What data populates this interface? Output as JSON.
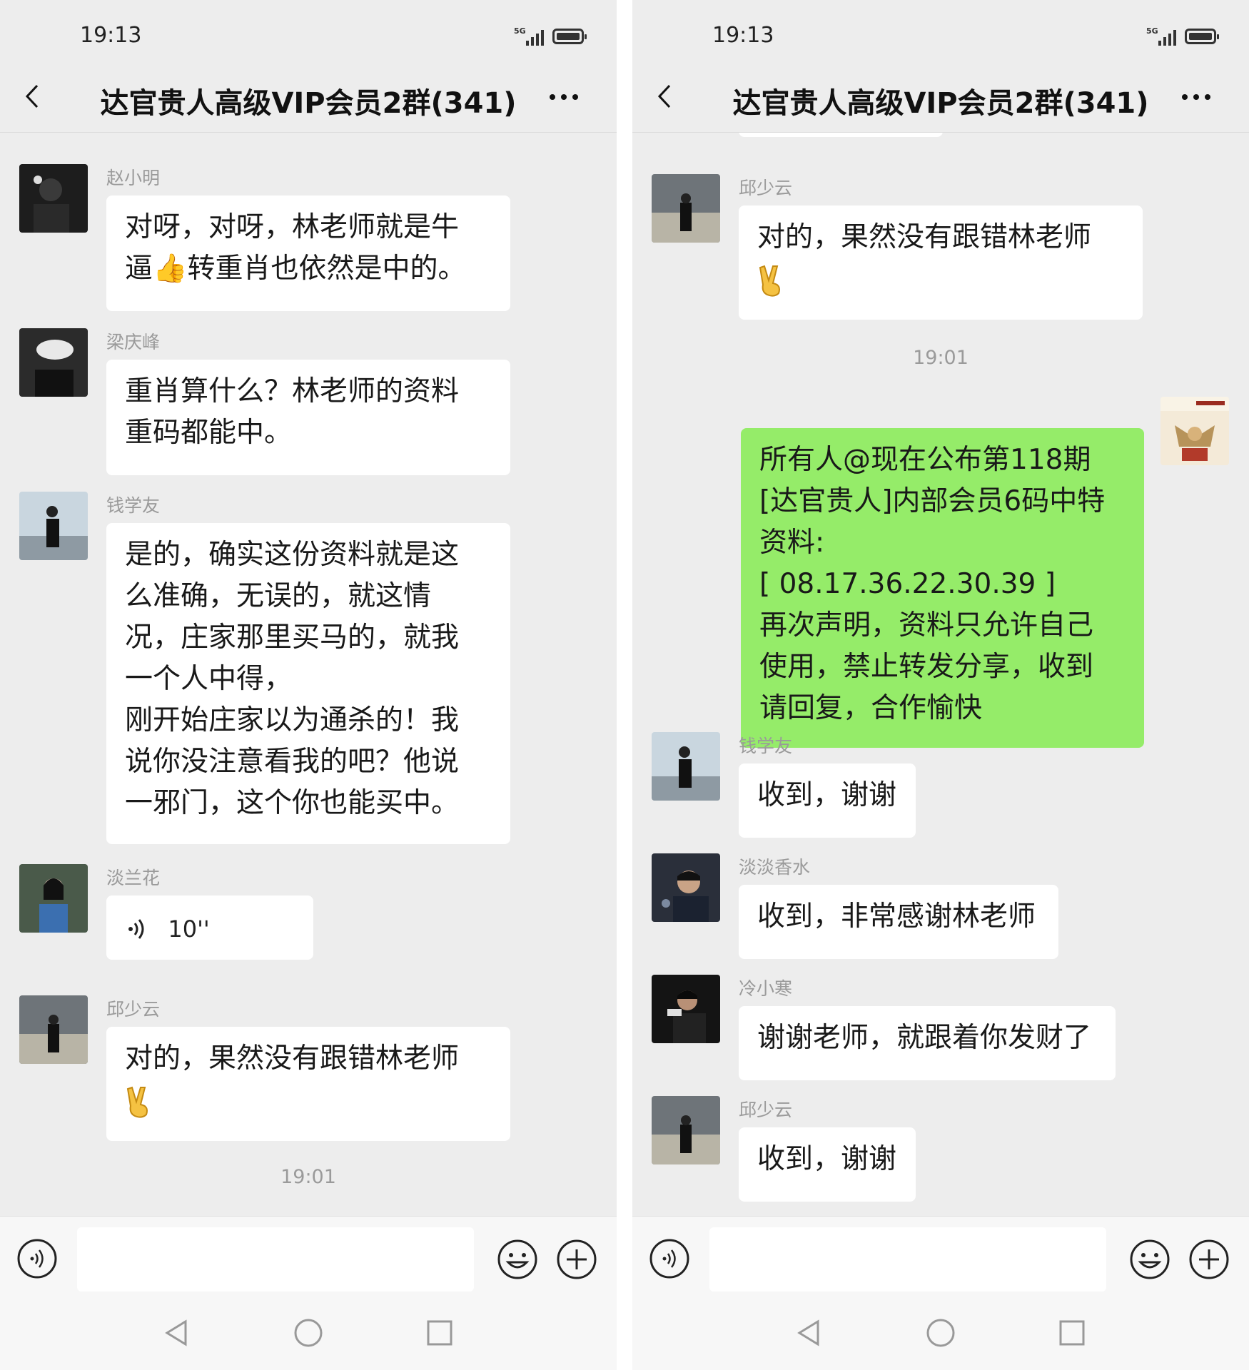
{
  "status_bar": {
    "time": "19:13",
    "network": "5G"
  },
  "chat": {
    "title": "达官贵人高级VIP会员2群(341)"
  },
  "left_screen": {
    "messages": [
      {
        "sender": "赵小明",
        "text": "对呀，对呀，林老师就是牛\n逼👍转重肖也依然是中的。"
      },
      {
        "sender": "梁庆峰",
        "text": "重肖算什么？林老师的资料\n重码都能中。"
      },
      {
        "sender": "钱学友",
        "text": "是的，确实这份资料就是这\n么准确，无误的，就这情\n况，庄家那里买马的，就我\n一个人中得，\n刚开始庄家以为通杀的！我\n说你没注意看我的吧？他说\n一邪门，这个你也能买中。"
      },
      {
        "sender": "淡兰花",
        "voice_duration": "10''"
      },
      {
        "sender": "邱少云",
        "text": "对的，果然没有跟错林老师"
      }
    ],
    "timestamp": "19:01"
  },
  "right_screen": {
    "messages_before": [
      {
        "sender": "邱少云",
        "text": "对的，果然没有跟错林老师"
      }
    ],
    "timestamp": "19:01",
    "outgoing": {
      "text": "所有人@现在公布第118期\n[达官贵人]内部会员6码中特\n资料:\n[      08.17.36.22.30.39   ]\n再次声明，资料只允许自己\n使用，禁止转发分享，收到\n请回复，合作愉快"
    },
    "replies": [
      {
        "sender": "钱学友",
        "text": "收到，谢谢"
      },
      {
        "sender": "淡淡香水",
        "text": "收到，非常感谢林老师"
      },
      {
        "sender": "冷小寒",
        "text": "谢谢老师，就跟着你发财了"
      },
      {
        "sender": "邱少云",
        "text": "收到，谢谢"
      }
    ]
  },
  "colors": {
    "outgoing_bubble": "#95ec69",
    "incoming_bubble": "#ffffff",
    "chat_background": "#ededed"
  }
}
